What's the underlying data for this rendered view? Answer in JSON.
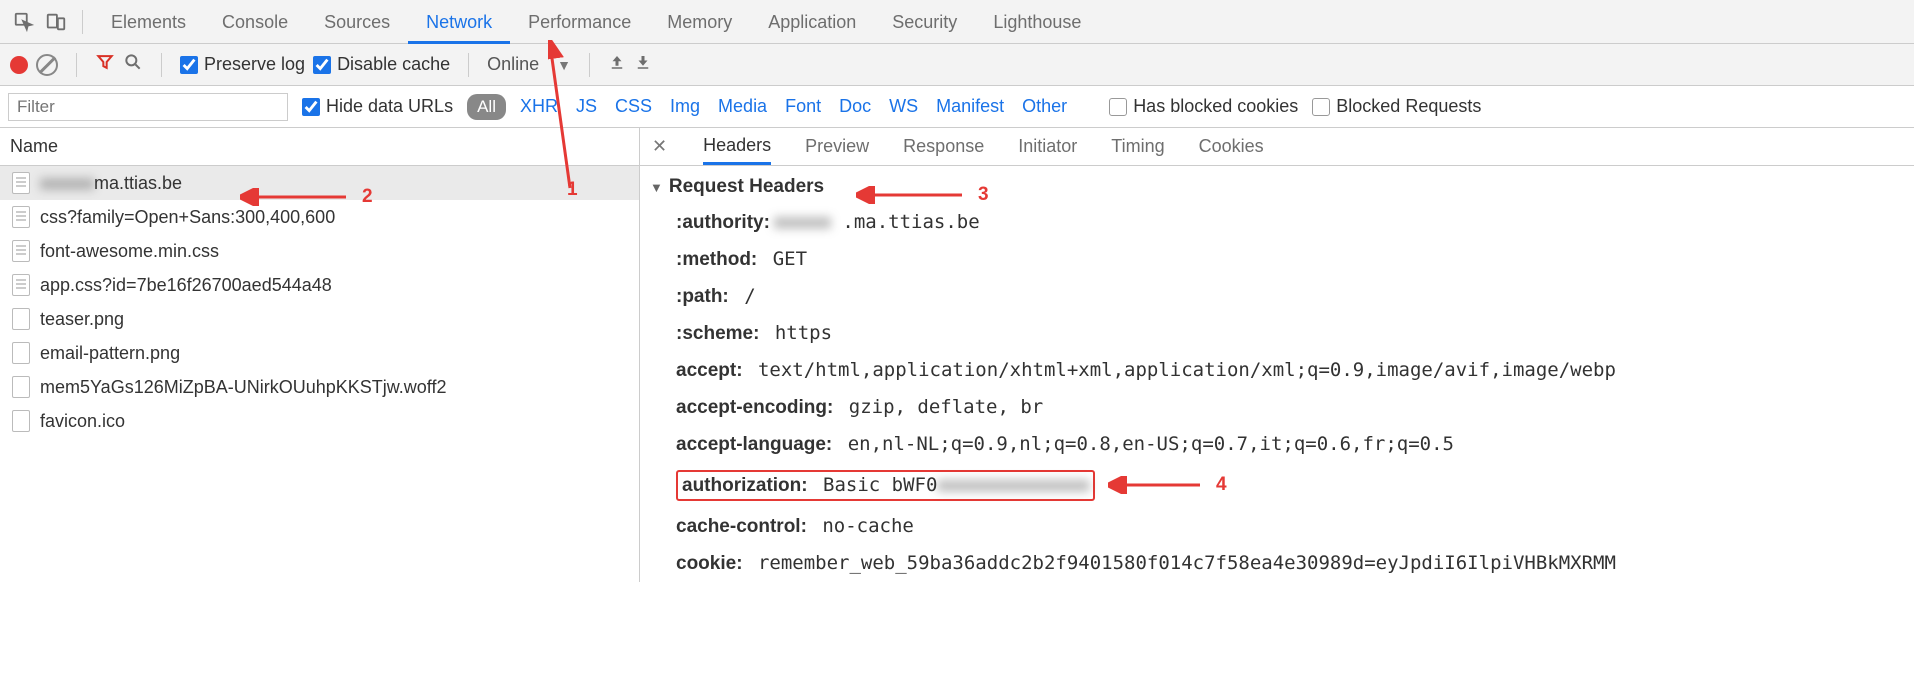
{
  "topTabs": [
    "Elements",
    "Console",
    "Sources",
    "Network",
    "Performance",
    "Memory",
    "Application",
    "Security",
    "Lighthouse"
  ],
  "topActiveIndex": 3,
  "toolbar": {
    "preserveLog": "Preserve log",
    "disableCache": "Disable cache",
    "throttling": "Online"
  },
  "filterbar": {
    "placeholder": "Filter",
    "hideDataUrls": "Hide data URLs",
    "all": "All",
    "types": [
      "XHR",
      "JS",
      "CSS",
      "Img",
      "Media",
      "Font",
      "Doc",
      "WS",
      "Manifest",
      "Other"
    ],
    "blocked": "Has blocked cookies",
    "blockedReq": "Blocked Requests"
  },
  "tableHeader": "Name",
  "requests": [
    {
      "name": "ma.ttias.be",
      "blurPrefix": true,
      "selected": true
    },
    {
      "name": "css?family=Open+Sans:300,400,600"
    },
    {
      "name": "font-awesome.min.css"
    },
    {
      "name": "app.css?id=7be16f26700aed544a48"
    },
    {
      "name": "teaser.png"
    },
    {
      "name": "email-pattern.png"
    },
    {
      "name": "mem5YaGs126MiZpBA-UNirkOUuhpKKSTjw.woff2"
    },
    {
      "name": "favicon.ico"
    }
  ],
  "detailTabs": [
    "Headers",
    "Preview",
    "Response",
    "Initiator",
    "Timing",
    "Cookies"
  ],
  "detailActiveIndex": 0,
  "sectionTitle": "Request Headers",
  "headers": [
    {
      "k": ":authority:",
      "v": ".ma.ttias.be",
      "blurPrefix": true
    },
    {
      "k": ":method:",
      "v": "GET"
    },
    {
      "k": ":path:",
      "v": "/"
    },
    {
      "k": ":scheme:",
      "v": "https"
    },
    {
      "k": "accept:",
      "v": "text/html,application/xhtml+xml,application/xml;q=0.9,image/avif,image/webp"
    },
    {
      "k": "accept-encoding:",
      "v": "gzip, deflate, br"
    },
    {
      "k": "accept-language:",
      "v": "en,nl-NL;q=0.9,nl;q=0.8,en-US;q=0.7,it;q=0.6,fr;q=0.5"
    },
    {
      "k": "authorization:",
      "v": "Basic bWF0",
      "blurSuffix": true,
      "highlight": true
    },
    {
      "k": "cache-control:",
      "v": "no-cache"
    },
    {
      "k": "cookie:",
      "v": "remember_web_59ba36addc2b2f9401580f014c7f58ea4e30989d=eyJpdiI6IlpiVHBkMXRMM"
    }
  ],
  "annotations": {
    "n1": "1",
    "n2": "2",
    "n3": "3",
    "n4": "4"
  }
}
